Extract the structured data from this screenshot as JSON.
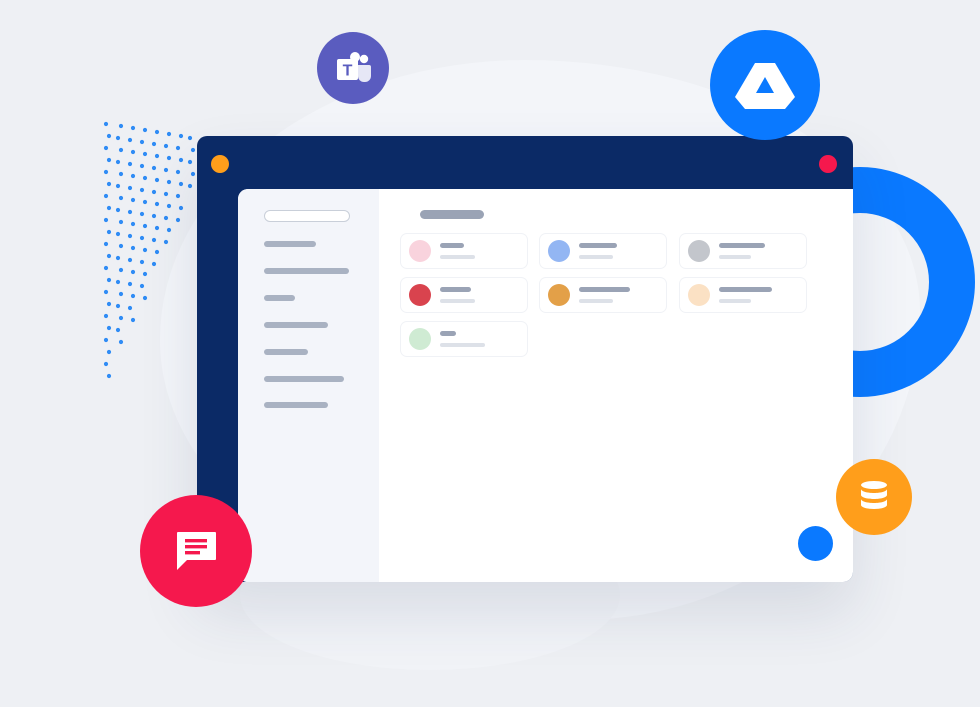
{
  "colors": {
    "window_frame": "#0b2a66",
    "accent_blue": "#0a79ff",
    "accent_orange": "#ff9e1b",
    "accent_red": "#f5184d",
    "teams_purple": "#5a5cbf"
  },
  "icons": {
    "teams": "microsoft-teams-icon",
    "drive": "google-drive-icon",
    "database": "database-icon",
    "chat": "chat-message-icon"
  },
  "teams_letter": "T",
  "cards": [
    {
      "avatar_color": "#f9d3dd"
    },
    {
      "avatar_color": "#93b6f3"
    },
    {
      "avatar_color": "#c3c6cc"
    },
    {
      "avatar_color": "#d9434e"
    },
    {
      "avatar_color": "#e3a048"
    },
    {
      "avatar_color": "#fbe1c4"
    },
    {
      "avatar_color": "#cfebd3"
    }
  ]
}
